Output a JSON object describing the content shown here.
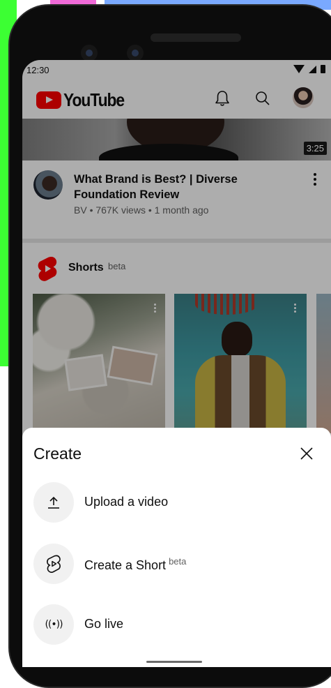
{
  "status_bar": {
    "time": "12:30"
  },
  "header": {
    "logo_text": "YouTube",
    "icons": [
      "bell-icon",
      "search-icon",
      "account-avatar"
    ]
  },
  "video": {
    "duration": "3:25",
    "title": "What Brand is Best? | Diverse Foundation Review",
    "meta": "BV • 767K views • 1 month ago"
  },
  "shorts_shelf": {
    "label": "Shorts",
    "badge": "beta"
  },
  "create_sheet": {
    "title": "Create",
    "options": [
      {
        "label": "Upload a video",
        "icon": "upload-icon"
      },
      {
        "label": "Create a Short",
        "badge": "beta",
        "icon": "shorts-create-icon"
      },
      {
        "label": "Go live",
        "icon": "live-icon"
      }
    ],
    "live_icon_glyph": "((•))"
  },
  "colors": {
    "brand_red": "#ff0000",
    "scrim": "rgba(0,0,0,0.32)",
    "sheet_bg": "#ffffff"
  }
}
